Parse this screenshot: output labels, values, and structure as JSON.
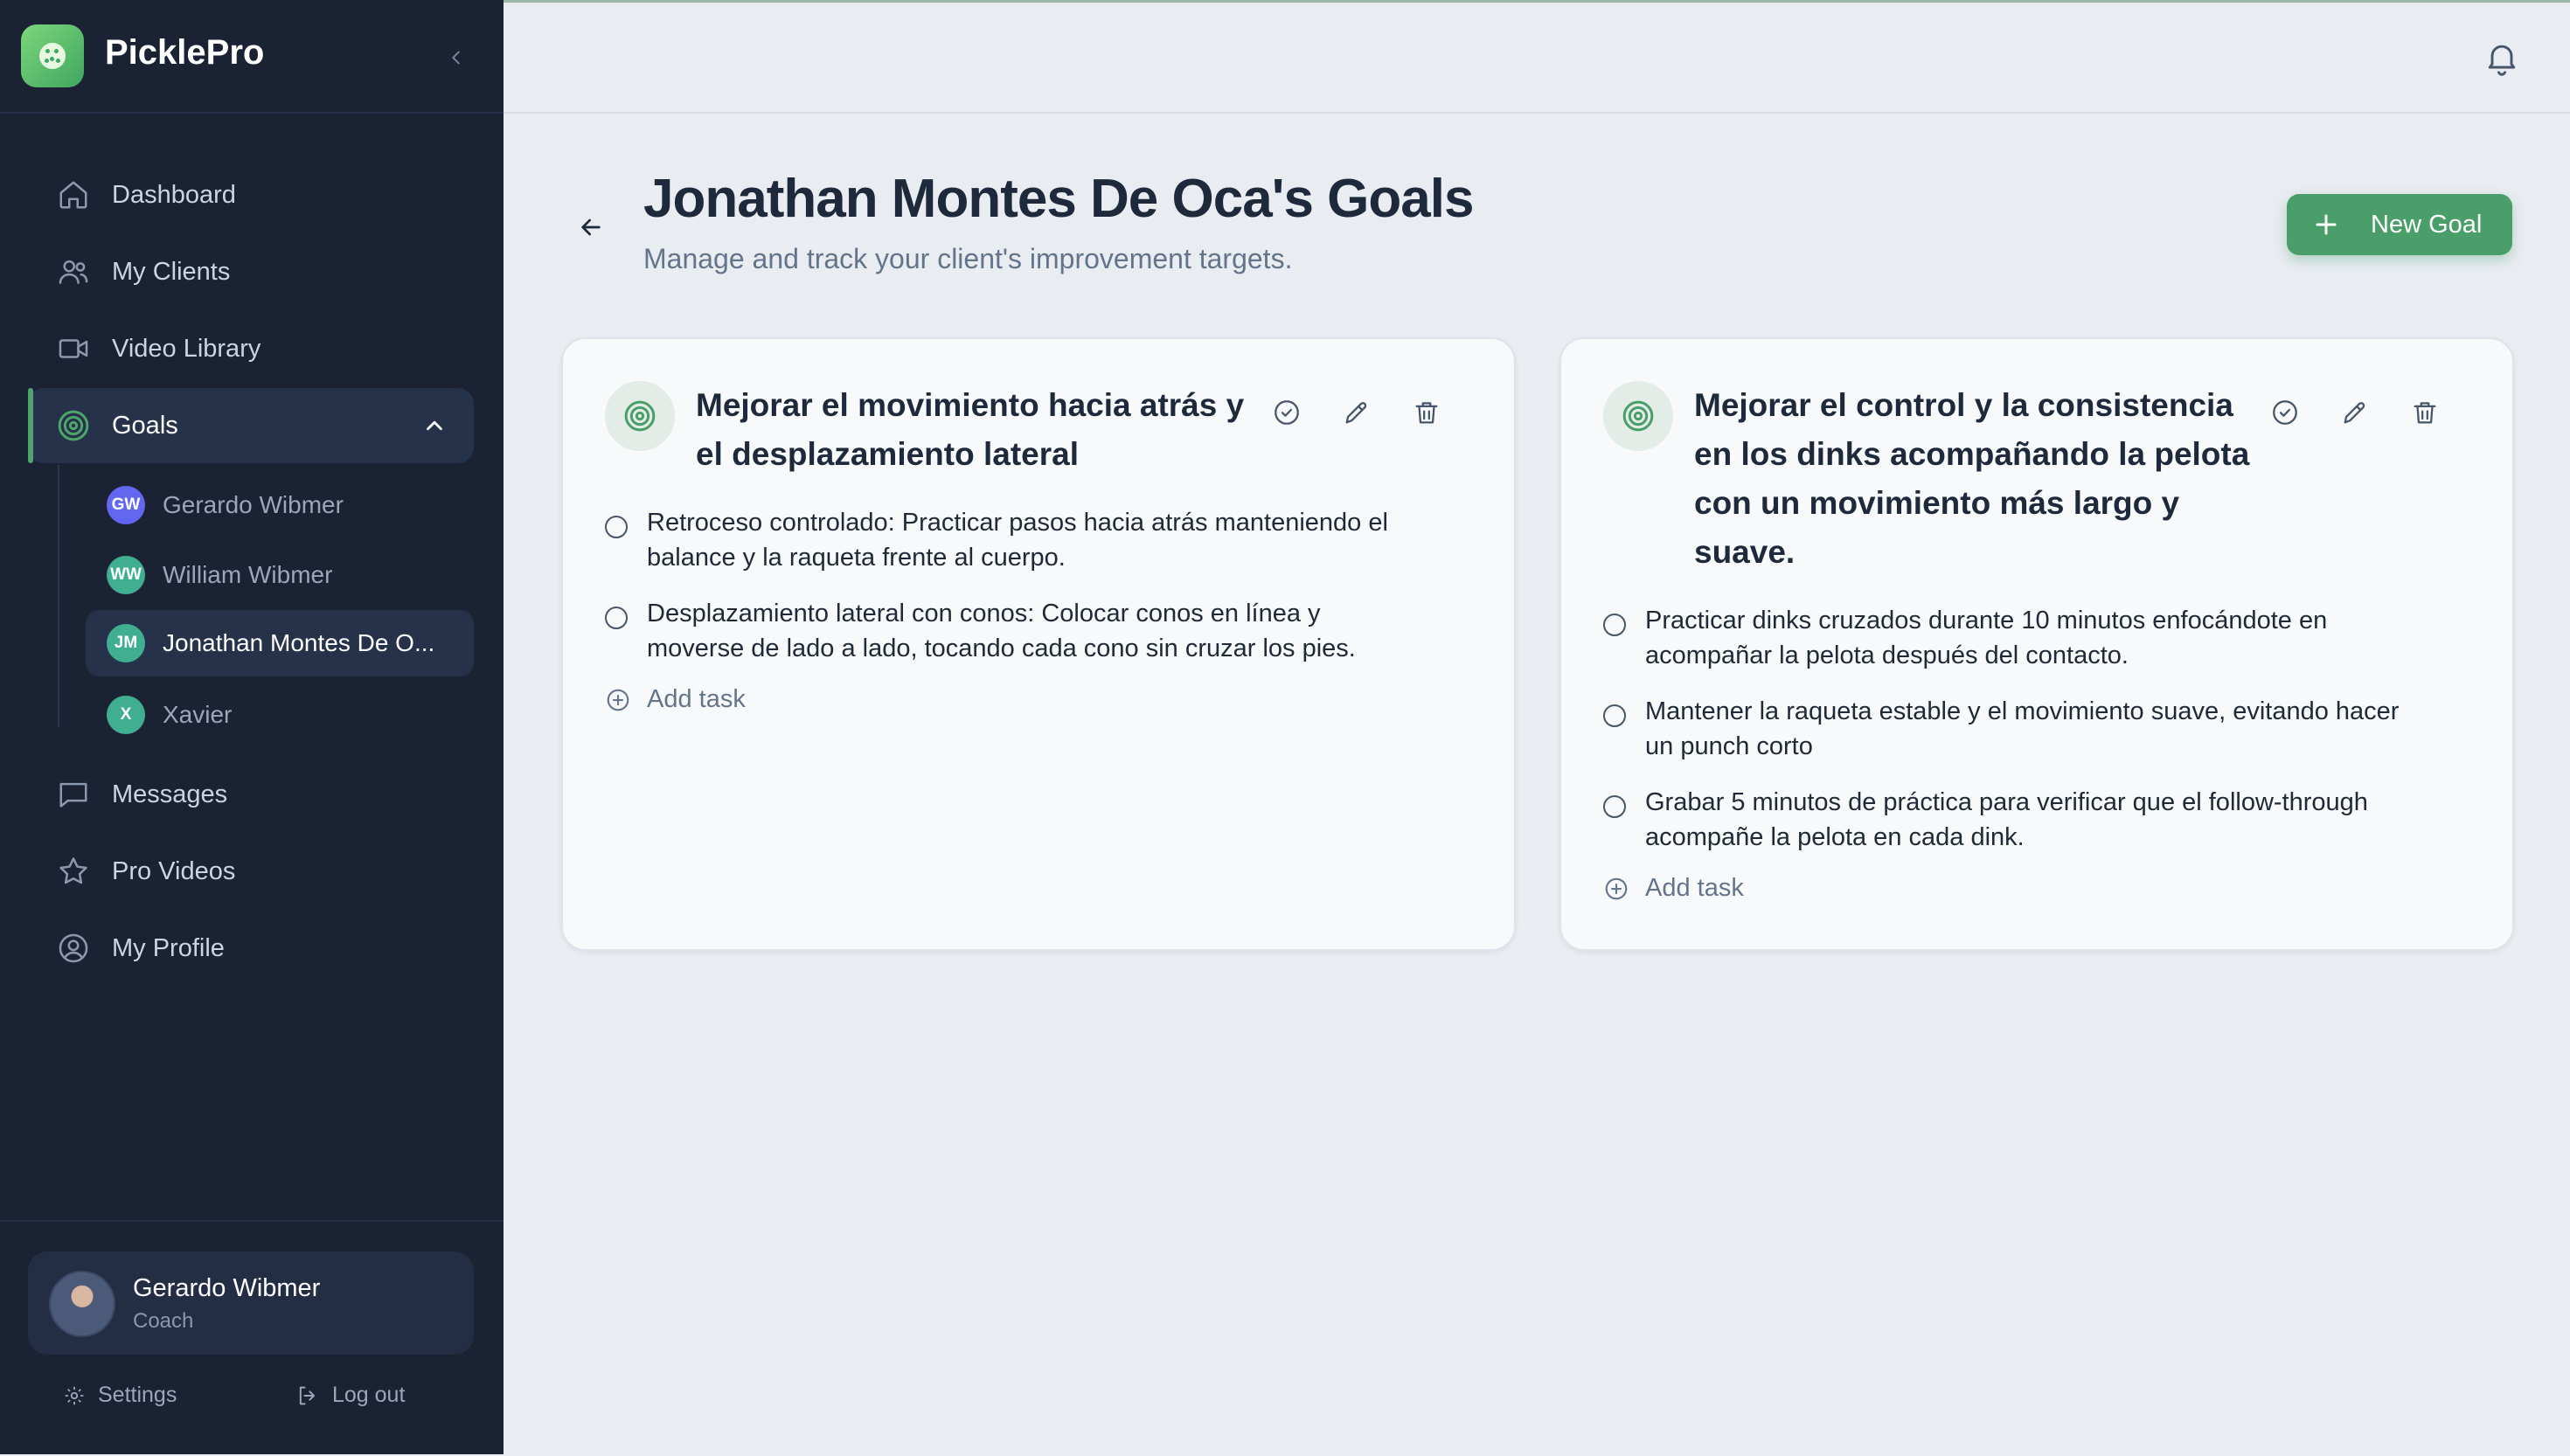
{
  "app": {
    "name": "PicklePro"
  },
  "sidebar": {
    "nav": [
      {
        "label": "Dashboard",
        "icon": "home-icon"
      },
      {
        "label": "My Clients",
        "icon": "users-icon"
      },
      {
        "label": "Video Library",
        "icon": "video-icon"
      },
      {
        "label": "Goals",
        "icon": "target-icon",
        "active": true
      },
      {
        "label": "Messages",
        "icon": "message-icon"
      },
      {
        "label": "Pro Videos",
        "icon": "star-icon"
      },
      {
        "label": "My Profile",
        "icon": "user-circle-icon"
      }
    ],
    "goal_clients": [
      {
        "initials": "GW",
        "name": "Gerardo Wibmer",
        "color": "#6366f1"
      },
      {
        "initials": "WW",
        "name": "William Wibmer",
        "color": "#3fae91"
      },
      {
        "initials": "JM",
        "name": "Jonathan Montes De O...",
        "color": "#3fae91",
        "active": true
      },
      {
        "initials": "X",
        "name": "Xavier",
        "color": "#3fae91"
      }
    ],
    "user": {
      "name": "Gerardo Wibmer",
      "role": "Coach"
    },
    "footer": {
      "settings": "Settings",
      "logout": "Log out"
    }
  },
  "header": {
    "title": "Jonathan Montes De Oca's Goals",
    "subtitle": "Manage and track your client's improvement targets.",
    "new_goal": "New Goal"
  },
  "goals": [
    {
      "title_lines": [
        "Mejorar el movimiento hacia atrás y",
        "el desplazamiento lateral"
      ],
      "tasks": [
        {
          "lines": [
            "Retroceso controlado: Practicar pasos hacia atrás manteniendo el",
            "balance y la raqueta frente al cuerpo."
          ]
        },
        {
          "lines": [
            "Desplazamiento lateral con conos: Colocar conos en línea y",
            "moverse de lado a lado, tocando cada cono sin cruzar los pies."
          ]
        }
      ],
      "add_task": "Add task"
    },
    {
      "title_lines": [
        "Mejorar el control y la consistencia",
        "en los dinks acompañando la pelota",
        "con un movimiento más largo y",
        "suave."
      ],
      "tasks": [
        {
          "lines": [
            "Practicar dinks cruzados durante 10 minutos enfocándote en",
            "acompañar la pelota después del contacto."
          ]
        },
        {
          "lines": [
            "Mantener la raqueta estable y el movimiento suave, evitando hacer",
            "un punch corto"
          ]
        },
        {
          "lines": [
            "Grabar 5 minutos de práctica para verificar que el follow-through",
            "acompañe la pelota en cada dink."
          ]
        }
      ],
      "add_task": "Add task"
    }
  ],
  "colors": {
    "sidebar_bg": "#1a2233",
    "accent": "#4a9e6a",
    "page_bg": "#e9ecf1"
  }
}
